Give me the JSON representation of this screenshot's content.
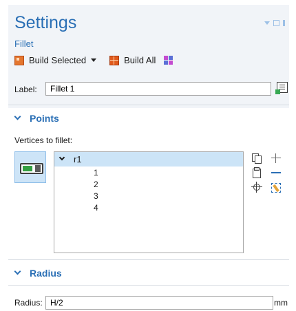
{
  "panel": {
    "title": "Settings",
    "subtitle": "Fillet"
  },
  "toolbar": {
    "build_selected_label": "Build Selected",
    "build_all_label": "Build All"
  },
  "label_field": {
    "label": "Label:",
    "value": "Fillet 1"
  },
  "points_section": {
    "title": "Points",
    "vertices_label": "Vertices to fillet:",
    "selection_active": true,
    "list": {
      "group": "r1",
      "items": [
        "1",
        "2",
        "3",
        "4"
      ]
    }
  },
  "radius_section": {
    "title": "Radius",
    "label": "Radius:",
    "value": "H/2",
    "unit": "mm"
  },
  "colors": {
    "accent": "#2a6fb5",
    "header_bg": "#f1f4f8",
    "selection_bg": "#cce4f7"
  }
}
